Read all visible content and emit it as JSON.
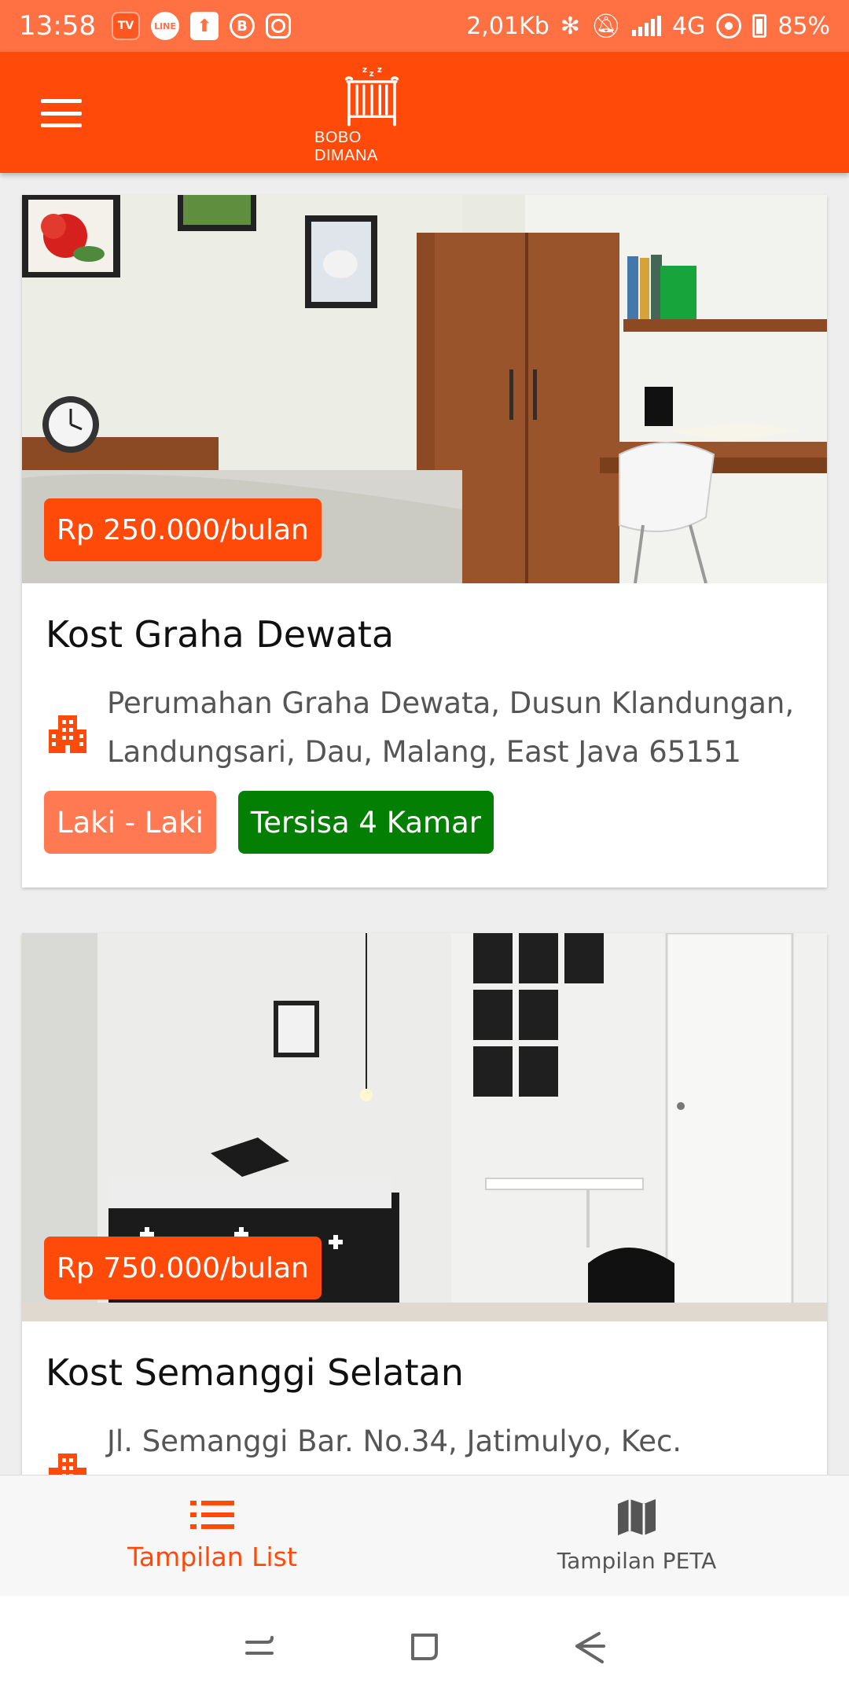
{
  "status_bar": {
    "time": "13:58",
    "net_speed": "2,01Kb",
    "network": "4G",
    "battery": "85%",
    "notification_icons": [
      "tv-icon",
      "line-icon",
      "upload-icon",
      "b-icon",
      "instagram-icon"
    ]
  },
  "app_bar": {
    "logo_text": "BOBO DIMANA"
  },
  "listings": [
    {
      "price": "Rp 250.000/bulan",
      "name": "Kost Graha Dewata",
      "address": "Perumahan Graha Dewata, Dusun Klandungan, Landungsari, Dau, Malang, East Java 65151",
      "gender": "Laki - Laki",
      "availability": "Tersisa 4 Kamar"
    },
    {
      "price": "Rp 750.000/bulan",
      "name": "Kost Semanggi Selatan",
      "address": "Jl. Semanggi Bar. No.34, Jatimulyo, Kec."
    }
  ],
  "bottom_nav": {
    "list_label": "Tampilan List",
    "map_label": "Tampilan PETA"
  },
  "colors": {
    "primary": "#ff4a0a",
    "gender_tag": "#ff7a52",
    "availability_tag": "#038003"
  }
}
